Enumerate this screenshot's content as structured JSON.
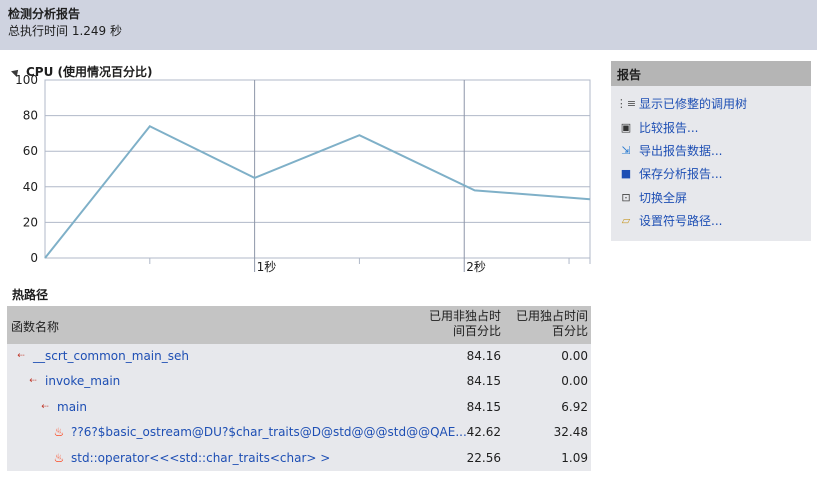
{
  "header": {
    "title": "检测分析报告",
    "subtitle": "总执行时间 1.249 秒"
  },
  "cpu": {
    "section_title": "CPU (使用情况百分比)"
  },
  "chart_data": {
    "type": "line",
    "title": "CPU (使用情况百分比)",
    "xlabel": "",
    "ylabel": "",
    "x_tick_labels": [
      "1秒",
      "2秒"
    ],
    "y_ticks": [
      0,
      20,
      40,
      60,
      80,
      100
    ],
    "ylim": [
      0,
      100
    ],
    "xlim": [
      0,
      2.6
    ],
    "grid": true,
    "series": [
      {
        "x": [
          0.0,
          0.5,
          1.0,
          1.5,
          2.05,
          2.6
        ],
        "y": [
          0,
          74,
          45,
          69,
          38,
          33
        ]
      }
    ],
    "colors": {
      "line": "#7fb0c8",
      "grid": "#b0b8c8",
      "major": "#8d96a8"
    }
  },
  "hot_path": {
    "title": "热路径",
    "columns": {
      "name": "函数名称",
      "inclusive": [
        "已用非独占时",
        "间百分比"
      ],
      "exclusive": [
        "已用独占时间",
        "百分比"
      ]
    },
    "rows": [
      {
        "name": "__scrt_common_main_seh",
        "inclusive": "84.16",
        "exclusive": "0.00",
        "icon": "call-tree-icon",
        "indent": 0
      },
      {
        "name": "invoke_main",
        "inclusive": "84.15",
        "exclusive": "0.00",
        "icon": "call-tree-icon",
        "indent": 1
      },
      {
        "name": "main",
        "inclusive": "84.15",
        "exclusive": "6.92",
        "icon": "call-tree-icon",
        "indent": 2
      },
      {
        "name": "??6?$basic_ostream@DU?$char_traits@D@std@@@std@@QAE...",
        "inclusive": "42.62",
        "exclusive": "32.48",
        "icon": "flame-icon",
        "indent": 3
      },
      {
        "name": "std::operator<<<std::char_traits<char> >",
        "inclusive": "22.56",
        "exclusive": "1.09",
        "icon": "flame-icon",
        "indent": 3
      }
    ]
  },
  "report_panel": {
    "title": "报告",
    "links": [
      {
        "label": "显示已修整的调用树",
        "icon": "call-tree-icon"
      },
      {
        "label": "比较报告...",
        "icon": "compare-icon"
      },
      {
        "label": "导出报告数据...",
        "icon": "export-icon"
      },
      {
        "label": "保存分析报告...",
        "icon": "save-icon"
      },
      {
        "label": "切换全屏",
        "icon": "fullscreen-icon"
      },
      {
        "label": "设置符号路径...",
        "icon": "folder-icon"
      }
    ]
  }
}
